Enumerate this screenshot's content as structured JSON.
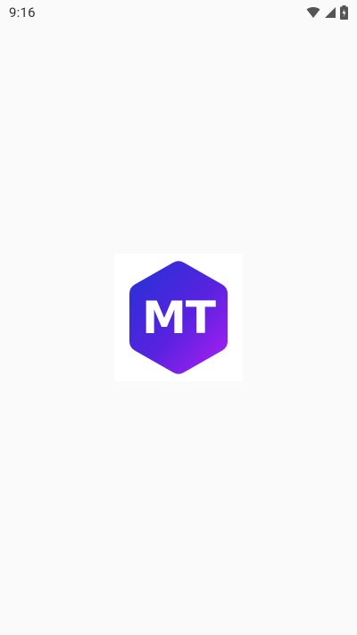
{
  "status_bar": {
    "time": "9:16",
    "icons": [
      "wifi-icon",
      "cellular-signal-icon",
      "battery-charging-icon"
    ]
  },
  "splash": {
    "logo_text": "MT",
    "colors": {
      "gradient_start": "#2233d6",
      "gradient_mid": "#5a22e0",
      "gradient_end": "#b01ff2"
    }
  },
  "colors": {
    "background": "#fafafa"
  }
}
